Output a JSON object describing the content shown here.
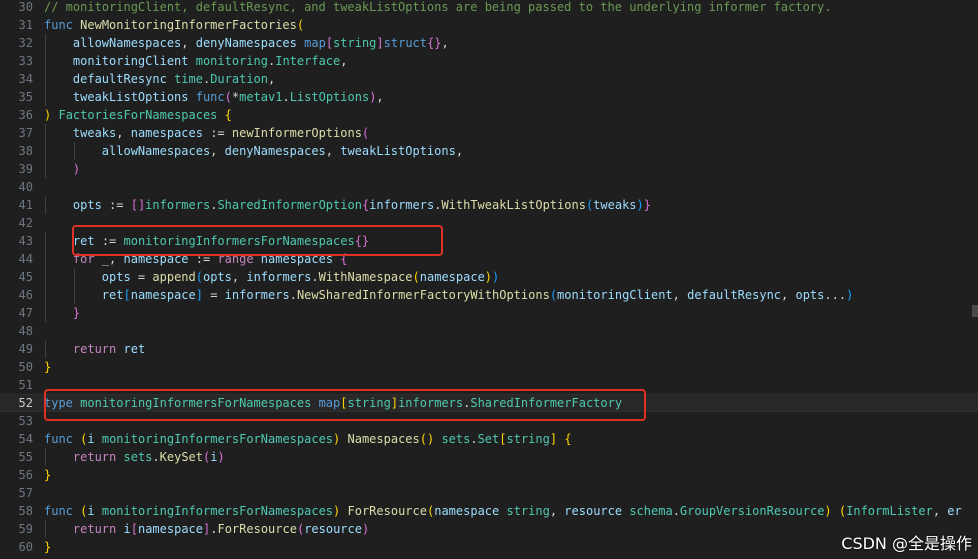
{
  "editor": {
    "current_line": "52",
    "lines": [
      {
        "n": "30",
        "indent": 0,
        "tokens": [
          [
            "cm",
            "// monitoringClient, defaultResync, and tweakListOptions are being passed to the underlying informer factory."
          ]
        ]
      },
      {
        "n": "31",
        "indent": 0,
        "tokens": [
          [
            "kw",
            "func"
          ],
          [
            "op",
            " "
          ],
          [
            "fn",
            "NewMonitoringInformerFactories"
          ],
          [
            "b1",
            "("
          ]
        ]
      },
      {
        "n": "32",
        "indent": 1,
        "tokens": [
          [
            "op",
            "    "
          ],
          [
            "id",
            "allowNamespaces"
          ],
          [
            "op",
            ", "
          ],
          [
            "id",
            "denyNamespaces"
          ],
          [
            "op",
            " "
          ],
          [
            "kw",
            "map"
          ],
          [
            "b2",
            "["
          ],
          [
            "ty",
            "string"
          ],
          [
            "b2",
            "]"
          ],
          [
            "kw",
            "struct"
          ],
          [
            "b2",
            "{}"
          ],
          [
            "op",
            ","
          ]
        ]
      },
      {
        "n": "33",
        "indent": 1,
        "tokens": [
          [
            "op",
            "    "
          ],
          [
            "id",
            "monitoringClient"
          ],
          [
            "op",
            " "
          ],
          [
            "ty",
            "monitoring"
          ],
          [
            "op",
            "."
          ],
          [
            "ty",
            "Interface"
          ],
          [
            "op",
            ","
          ]
        ]
      },
      {
        "n": "34",
        "indent": 1,
        "tokens": [
          [
            "op",
            "    "
          ],
          [
            "id",
            "defaultResync"
          ],
          [
            "op",
            " "
          ],
          [
            "ty",
            "time"
          ],
          [
            "op",
            "."
          ],
          [
            "ty",
            "Duration"
          ],
          [
            "op",
            ","
          ]
        ]
      },
      {
        "n": "35",
        "indent": 1,
        "tokens": [
          [
            "op",
            "    "
          ],
          [
            "id",
            "tweakListOptions"
          ],
          [
            "op",
            " "
          ],
          [
            "kw",
            "func"
          ],
          [
            "b2",
            "("
          ],
          [
            "op",
            "*"
          ],
          [
            "ty",
            "metav1"
          ],
          [
            "op",
            "."
          ],
          [
            "ty",
            "ListOptions"
          ],
          [
            "b2",
            ")"
          ],
          [
            "op",
            ","
          ]
        ]
      },
      {
        "n": "36",
        "indent": 0,
        "tokens": [
          [
            "b1",
            ")"
          ],
          [
            "op",
            " "
          ],
          [
            "ty",
            "FactoriesForNamespaces"
          ],
          [
            "op",
            " "
          ],
          [
            "b1",
            "{"
          ]
        ]
      },
      {
        "n": "37",
        "indent": 1,
        "tokens": [
          [
            "op",
            "    "
          ],
          [
            "id",
            "tweaks"
          ],
          [
            "op",
            ", "
          ],
          [
            "id",
            "namespaces"
          ],
          [
            "op",
            " := "
          ],
          [
            "fn",
            "newInformerOptions"
          ],
          [
            "b2",
            "("
          ]
        ]
      },
      {
        "n": "38",
        "indent": 2,
        "tokens": [
          [
            "op",
            "        "
          ],
          [
            "id",
            "allowNamespaces"
          ],
          [
            "op",
            ", "
          ],
          [
            "id",
            "denyNamespaces"
          ],
          [
            "op",
            ", "
          ],
          [
            "id",
            "tweakListOptions"
          ],
          [
            "op",
            ","
          ]
        ]
      },
      {
        "n": "39",
        "indent": 1,
        "tokens": [
          [
            "op",
            "    "
          ],
          [
            "b2",
            ")"
          ]
        ]
      },
      {
        "n": "40",
        "indent": 1,
        "tokens": []
      },
      {
        "n": "41",
        "indent": 1,
        "tokens": [
          [
            "op",
            "    "
          ],
          [
            "id",
            "opts"
          ],
          [
            "op",
            " := "
          ],
          [
            "b2",
            "[]"
          ],
          [
            "ty",
            "informers"
          ],
          [
            "op",
            "."
          ],
          [
            "ty",
            "SharedInformerOption"
          ],
          [
            "b2",
            "{"
          ],
          [
            "id",
            "informers"
          ],
          [
            "op",
            "."
          ],
          [
            "fn",
            "WithTweakListOptions"
          ],
          [
            "b3",
            "("
          ],
          [
            "id",
            "tweaks"
          ],
          [
            "b3",
            ")"
          ],
          [
            "b2",
            "}"
          ]
        ]
      },
      {
        "n": "42",
        "indent": 1,
        "tokens": []
      },
      {
        "n": "43",
        "indent": 1,
        "tokens": [
          [
            "op",
            "    "
          ],
          [
            "id",
            "ret"
          ],
          [
            "op",
            " := "
          ],
          [
            "ty",
            "monitoringInformersForNamespaces"
          ],
          [
            "b2",
            "{}"
          ]
        ]
      },
      {
        "n": "44",
        "indent": 1,
        "tokens": [
          [
            "op",
            "    "
          ],
          [
            "ctl",
            "for"
          ],
          [
            "op",
            " _, "
          ],
          [
            "id",
            "namespace"
          ],
          [
            "op",
            " := "
          ],
          [
            "ctl",
            "range"
          ],
          [
            "op",
            " "
          ],
          [
            "id",
            "namespaces"
          ],
          [
            "op",
            " "
          ],
          [
            "b2",
            "{"
          ]
        ]
      },
      {
        "n": "45",
        "indent": 2,
        "tokens": [
          [
            "op",
            "        "
          ],
          [
            "id",
            "opts"
          ],
          [
            "op",
            " = "
          ],
          [
            "fn",
            "append"
          ],
          [
            "b3",
            "("
          ],
          [
            "id",
            "opts"
          ],
          [
            "op",
            ", "
          ],
          [
            "id",
            "informers"
          ],
          [
            "op",
            "."
          ],
          [
            "fn",
            "WithNamespace"
          ],
          [
            "b1",
            "("
          ],
          [
            "id",
            "namespace"
          ],
          [
            "b1",
            ")"
          ],
          [
            "b3",
            ")"
          ]
        ]
      },
      {
        "n": "46",
        "indent": 2,
        "tokens": [
          [
            "op",
            "        "
          ],
          [
            "id",
            "ret"
          ],
          [
            "b3",
            "["
          ],
          [
            "id",
            "namespace"
          ],
          [
            "b3",
            "]"
          ],
          [
            "op",
            " = "
          ],
          [
            "id",
            "informers"
          ],
          [
            "op",
            "."
          ],
          [
            "fn",
            "NewSharedInformerFactoryWithOptions"
          ],
          [
            "b3",
            "("
          ],
          [
            "id",
            "monitoringClient"
          ],
          [
            "op",
            ", "
          ],
          [
            "id",
            "defaultResync"
          ],
          [
            "op",
            ", "
          ],
          [
            "id",
            "opts"
          ],
          [
            "op",
            "..."
          ],
          [
            "b3",
            ")"
          ]
        ]
      },
      {
        "n": "47",
        "indent": 1,
        "tokens": [
          [
            "op",
            "    "
          ],
          [
            "b2",
            "}"
          ]
        ]
      },
      {
        "n": "48",
        "indent": 1,
        "tokens": []
      },
      {
        "n": "49",
        "indent": 1,
        "tokens": [
          [
            "op",
            "    "
          ],
          [
            "ctl",
            "return"
          ],
          [
            "op",
            " "
          ],
          [
            "id",
            "ret"
          ]
        ]
      },
      {
        "n": "50",
        "indent": 0,
        "tokens": [
          [
            "b1",
            "}"
          ]
        ]
      },
      {
        "n": "51",
        "indent": 0,
        "tokens": []
      },
      {
        "n": "52",
        "indent": 0,
        "tokens": [
          [
            "kw",
            "type"
          ],
          [
            "op",
            " "
          ],
          [
            "ty",
            "monitoringInformersForNamespaces"
          ],
          [
            "op",
            " "
          ],
          [
            "kw",
            "map"
          ],
          [
            "b1",
            "["
          ],
          [
            "ty",
            "string"
          ],
          [
            "b1",
            "]"
          ],
          [
            "ty",
            "informers"
          ],
          [
            "op",
            "."
          ],
          [
            "ty",
            "SharedInformerFactory"
          ]
        ]
      },
      {
        "n": "53",
        "indent": 0,
        "tokens": []
      },
      {
        "n": "54",
        "indent": 0,
        "tokens": [
          [
            "kw",
            "func"
          ],
          [
            "op",
            " "
          ],
          [
            "b1",
            "("
          ],
          [
            "id",
            "i"
          ],
          [
            "op",
            " "
          ],
          [
            "ty",
            "monitoringInformersForNamespaces"
          ],
          [
            "b1",
            ")"
          ],
          [
            "op",
            " "
          ],
          [
            "fn",
            "Namespaces"
          ],
          [
            "b1",
            "()"
          ],
          [
            "op",
            " "
          ],
          [
            "ty",
            "sets"
          ],
          [
            "op",
            "."
          ],
          [
            "ty",
            "Set"
          ],
          [
            "b1",
            "["
          ],
          [
            "ty",
            "string"
          ],
          [
            "b1",
            "]"
          ],
          [
            "op",
            " "
          ],
          [
            "b1",
            "{"
          ]
        ]
      },
      {
        "n": "55",
        "indent": 1,
        "tokens": [
          [
            "op",
            "    "
          ],
          [
            "ctl",
            "return"
          ],
          [
            "op",
            " "
          ],
          [
            "ty",
            "sets"
          ],
          [
            "op",
            "."
          ],
          [
            "fn",
            "KeySet"
          ],
          [
            "b2",
            "("
          ],
          [
            "id",
            "i"
          ],
          [
            "b2",
            ")"
          ]
        ]
      },
      {
        "n": "56",
        "indent": 0,
        "tokens": [
          [
            "b1",
            "}"
          ]
        ]
      },
      {
        "n": "57",
        "indent": 0,
        "tokens": []
      },
      {
        "n": "58",
        "indent": 0,
        "tokens": [
          [
            "kw",
            "func"
          ],
          [
            "op",
            " "
          ],
          [
            "b1",
            "("
          ],
          [
            "id",
            "i"
          ],
          [
            "op",
            " "
          ],
          [
            "ty",
            "monitoringInformersForNamespaces"
          ],
          [
            "b1",
            ")"
          ],
          [
            "op",
            " "
          ],
          [
            "fn",
            "ForResource"
          ],
          [
            "b1",
            "("
          ],
          [
            "id",
            "namespace"
          ],
          [
            "op",
            " "
          ],
          [
            "ty",
            "string"
          ],
          [
            "op",
            ", "
          ],
          [
            "id",
            "resource"
          ],
          [
            "op",
            " "
          ],
          [
            "ty",
            "schema"
          ],
          [
            "op",
            "."
          ],
          [
            "ty",
            "GroupVersionResource"
          ],
          [
            "b1",
            ")"
          ],
          [
            "op",
            " "
          ],
          [
            "b1",
            "("
          ],
          [
            "ty",
            "InformLister"
          ],
          [
            "op",
            ", "
          ],
          [
            "id",
            "er"
          ]
        ]
      },
      {
        "n": "59",
        "indent": 1,
        "tokens": [
          [
            "op",
            "    "
          ],
          [
            "ctl",
            "return"
          ],
          [
            "op",
            " "
          ],
          [
            "id",
            "i"
          ],
          [
            "b2",
            "["
          ],
          [
            "id",
            "namespace"
          ],
          [
            "b2",
            "]"
          ],
          [
            "op",
            "."
          ],
          [
            "fn",
            "ForResource"
          ],
          [
            "b2",
            "("
          ],
          [
            "id",
            "resource"
          ],
          [
            "b2",
            ")"
          ]
        ]
      },
      {
        "n": "60",
        "indent": 0,
        "tokens": [
          [
            "b1",
            "}"
          ]
        ]
      }
    ]
  },
  "annotations": {
    "box_color": "#e03128"
  },
  "watermark": {
    "text": "CSDN @全是操作"
  }
}
